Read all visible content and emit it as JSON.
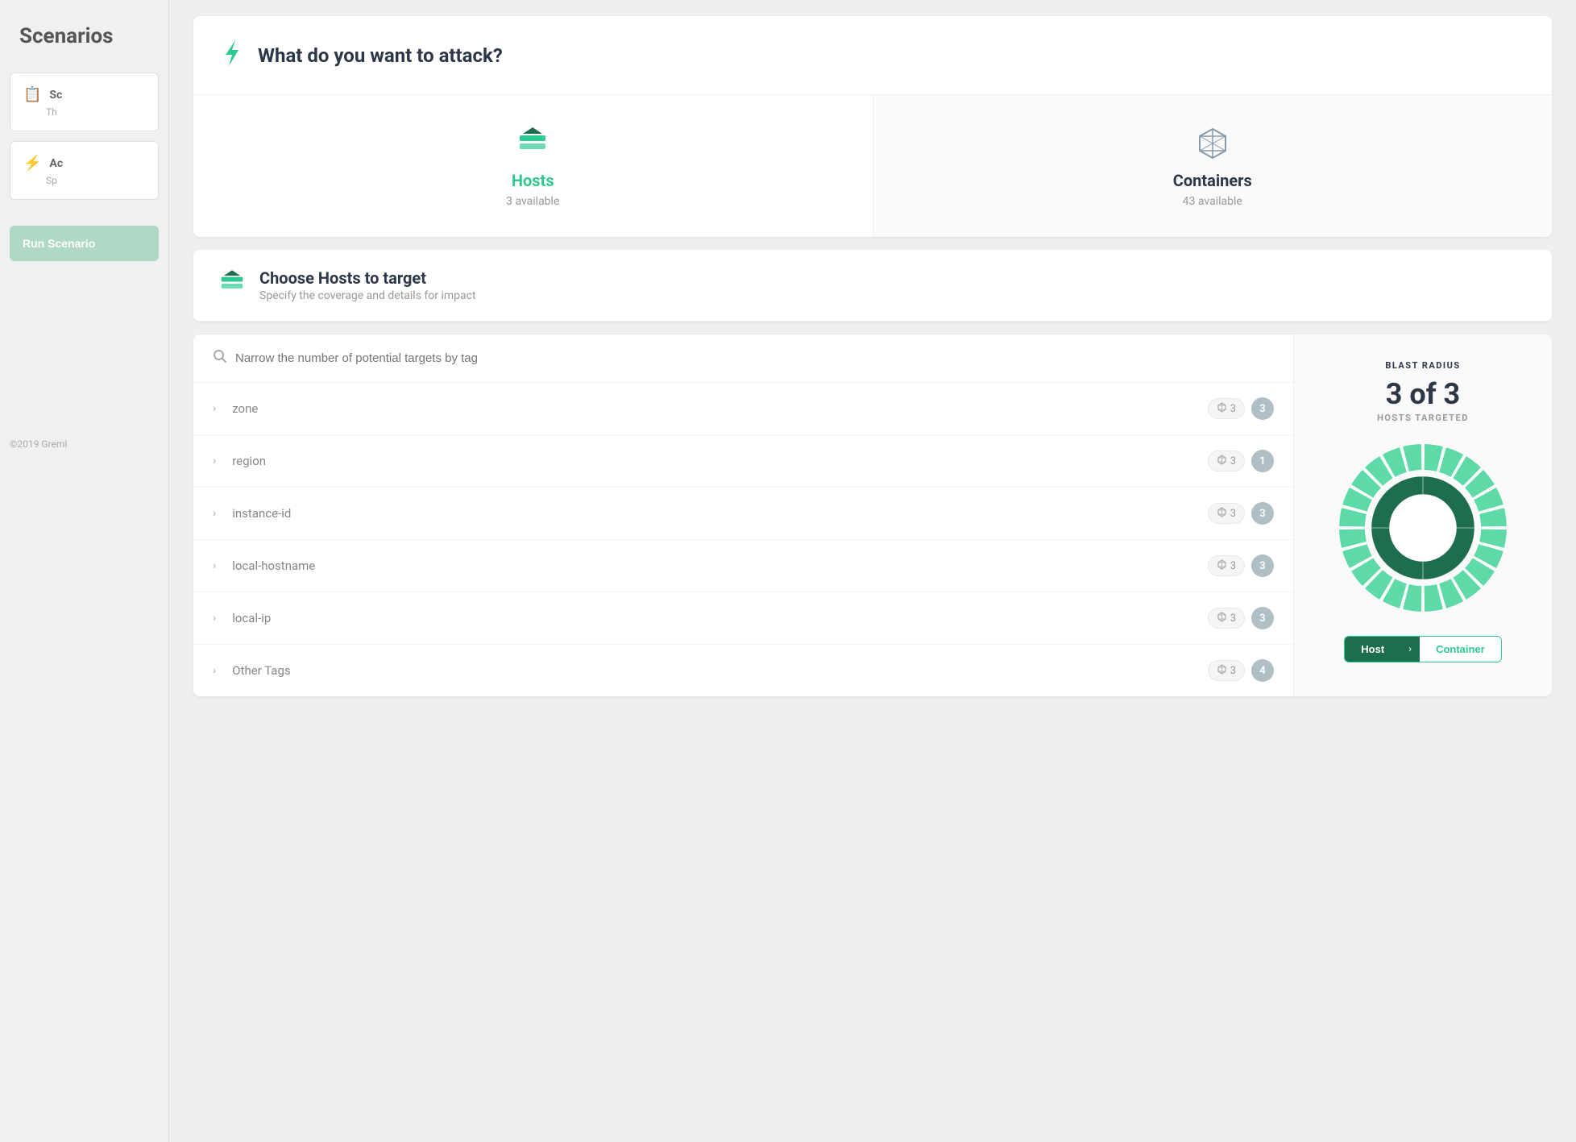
{
  "sidebar": {
    "title": "Scenarios",
    "cards": [
      {
        "id": "scenario",
        "icon": "clipboard",
        "title": "Sc",
        "subtitle": "Th"
      },
      {
        "id": "attack",
        "icon": "lightning",
        "title": "Ac",
        "subtitle": "Sp"
      }
    ],
    "run_button": "Run Scenario",
    "footer": "©2019 Greml"
  },
  "attack_section": {
    "title": "What do you want to attack?"
  },
  "targets": [
    {
      "id": "hosts",
      "label": "Hosts",
      "count": "3 available",
      "active": true
    },
    {
      "id": "containers",
      "label": "Containers",
      "count": "43 available",
      "active": false
    }
  ],
  "choose_hosts": {
    "title": "Choose Hosts to target",
    "subtitle": "Specify the coverage and details for impact"
  },
  "tag_search": {
    "placeholder": "Narrow the number of potential targets by tag"
  },
  "tags": [
    {
      "name": "zone",
      "container_count": "3",
      "host_count": "3"
    },
    {
      "name": "region",
      "container_count": "3",
      "host_count": "1"
    },
    {
      "name": "instance-id",
      "container_count": "3",
      "host_count": "3"
    },
    {
      "name": "local-hostname",
      "container_count": "3",
      "host_count": "3"
    },
    {
      "name": "local-ip",
      "container_count": "3",
      "host_count": "3"
    },
    {
      "name": "Other Tags",
      "container_count": "3",
      "host_count": "4"
    }
  ],
  "blast_radius": {
    "label": "BLAST RADIUS",
    "fraction": "3 of 3",
    "sub": "HOSTS TARGETED"
  },
  "toggle": {
    "host_label": "Host",
    "container_label": "Container"
  },
  "colors": {
    "green_dark": "#1e6e4e",
    "green_main": "#2ec98e",
    "green_light": "#5ed9a8"
  }
}
